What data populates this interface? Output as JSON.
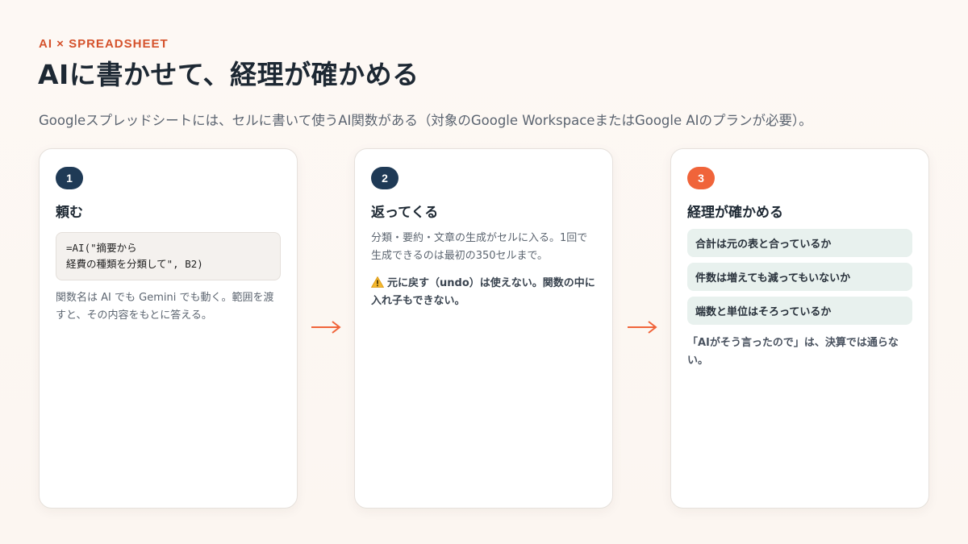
{
  "header": {
    "eyebrow": "AI × SPREADSHEET",
    "title": "AIに書かせて、経理が確かめる",
    "subtitle": "Googleスプレッドシートには、セルに書いて使うAI関数がある（対象のGoogle WorkspaceまたはGoogle AIのプランが必要）。"
  },
  "colors": {
    "accent": "#f0643a",
    "eyebrow": "#d5522c",
    "badge": "#1f3a56",
    "check_bg": "#e8f1ee"
  },
  "cards": [
    {
      "number": "1",
      "title": "頼む",
      "code": "=AI(\"摘要から\n経費の種類を分類して\", B2)",
      "description": "関数名は AI でも Gemini でも動く。範囲を渡すと、その内容をもとに答える。"
    },
    {
      "number": "2",
      "title": "返ってくる",
      "description": "分類・要約・文章の生成がセルに入る。1回で生成できるのは最初の350セルまで。",
      "warning_icon": "warning-icon",
      "warning": "元に戻す（undo）は使えない。関数の中に入れ子もできない。"
    },
    {
      "number": "3",
      "title": "経理が確かめる",
      "checks": [
        "合計は元の表と合っているか",
        "件数は増えても減ってもいないか",
        "端数と単位はそろっているか"
      ],
      "closing": "「AIがそう言ったので」は、決算では通らない。"
    }
  ],
  "arrows": [
    "arrow-right-icon",
    "arrow-right-icon"
  ]
}
